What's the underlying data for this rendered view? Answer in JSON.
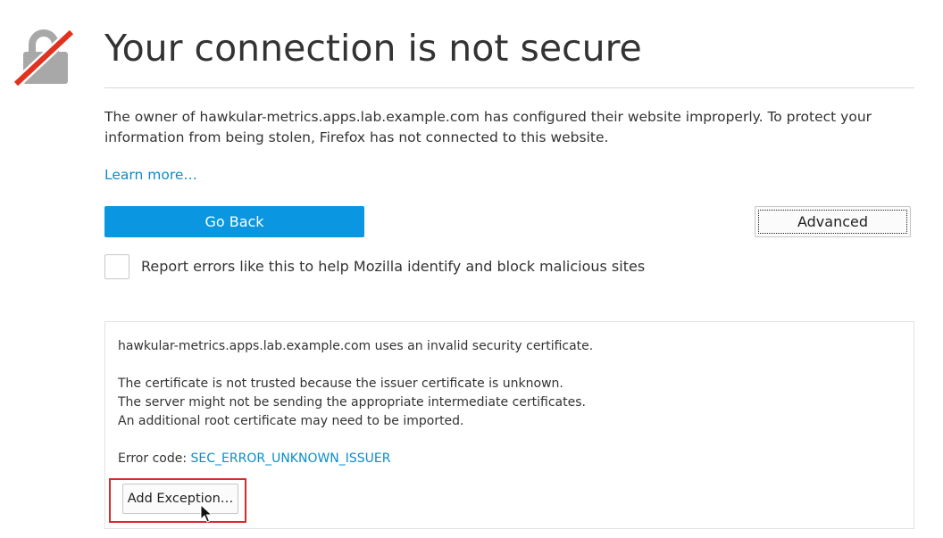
{
  "page": {
    "title": "Your connection is not secure",
    "description": "The owner of hawkular-metrics.apps.lab.example.com has configured their website improperly. To protect your information from being stolen, Firefox has not connected to this website.",
    "learn_more": "Learn more…",
    "icon": "broken-lock-icon"
  },
  "actions": {
    "go_back": "Go Back",
    "advanced": "Advanced"
  },
  "report": {
    "checked": false,
    "label": "Report errors like this to help Mozilla identify and block malicious sites"
  },
  "advanced_panel": {
    "invalid_cert": "hawkular-metrics.apps.lab.example.com uses an invalid security certificate.",
    "reasons": [
      "The certificate is not trusted because the issuer certificate is unknown.",
      "The server might not be sending the appropriate intermediate certificates.",
      "An additional root certificate may need to be imported."
    ],
    "error_code_label": "Error code:",
    "error_code": "SEC_ERROR_UNKNOWN_ISSUER",
    "add_exception": "Add Exception…"
  },
  "colors": {
    "primary_button": "#0a96e0",
    "link": "#0a8dcc",
    "highlight_border": "#d62b2b",
    "lock_gray": "#a8a8a8",
    "lock_slash": "#e1311f"
  }
}
